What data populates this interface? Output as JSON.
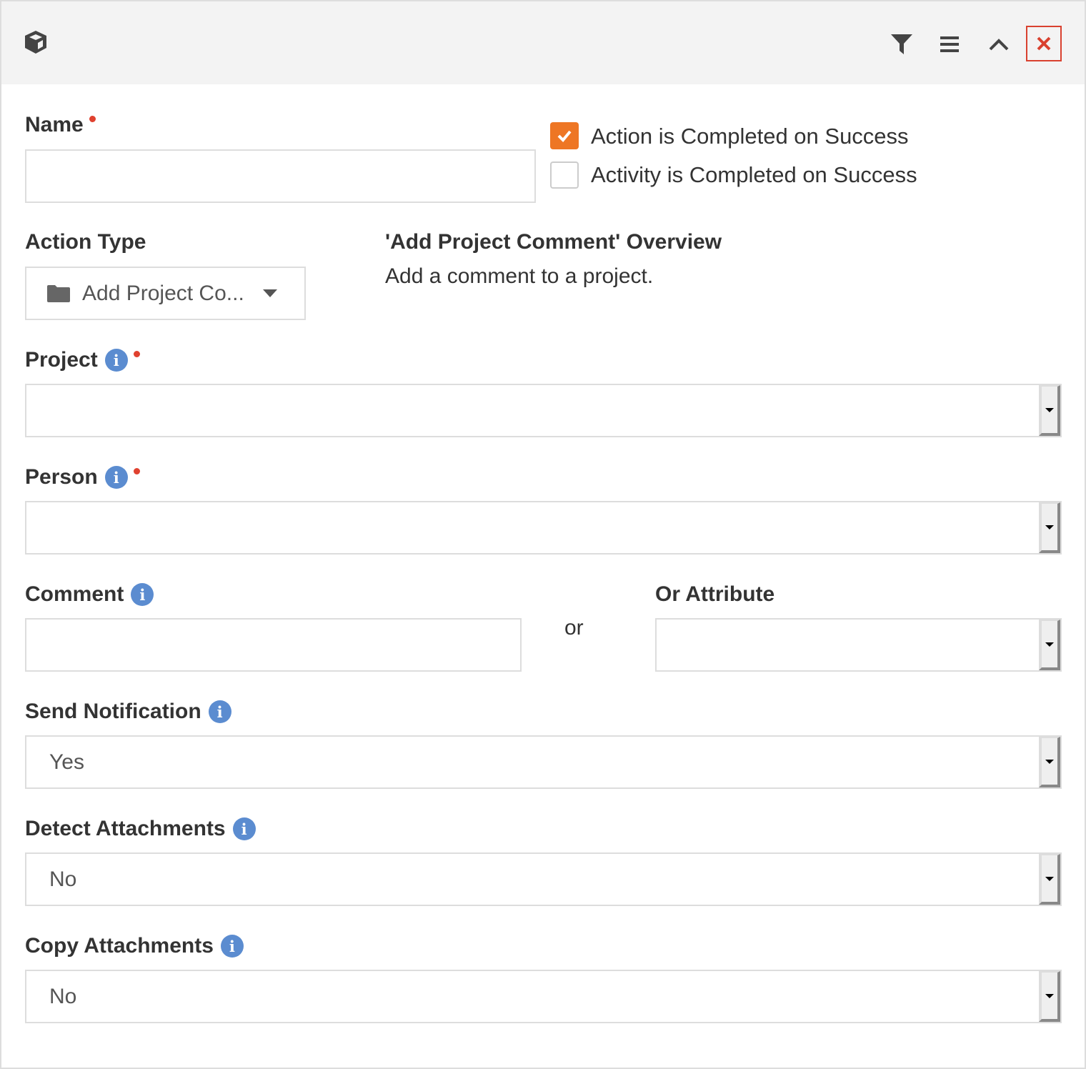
{
  "header": {
    "icons": [
      "cube-icon",
      "filter-icon",
      "menu-icon",
      "chevron-up-icon",
      "close-icon"
    ]
  },
  "colors": {
    "accent": "#ee7624",
    "required": "#e0412f",
    "info": "#5b8cd0",
    "close": "#d9412f"
  },
  "name": {
    "label": "Name",
    "value": ""
  },
  "checkboxes": [
    {
      "label": "Action is Completed on Success",
      "checked": true
    },
    {
      "label": "Activity is Completed on Success",
      "checked": false
    }
  ],
  "action_type": {
    "label": "Action Type",
    "value": "Add Project Co...",
    "icon": "folder-icon"
  },
  "overview": {
    "title": "'Add Project Comment' Overview",
    "text": "Add a comment to a project."
  },
  "project": {
    "label": "Project",
    "value": ""
  },
  "person": {
    "label": "Person",
    "value": ""
  },
  "comment": {
    "label": "Comment",
    "value": "",
    "or": "or"
  },
  "or_attribute": {
    "label": "Or Attribute",
    "value": ""
  },
  "send_notification": {
    "label": "Send Notification",
    "value": "Yes"
  },
  "detect_attachments": {
    "label": "Detect Attachments",
    "value": "No"
  },
  "copy_attachments": {
    "label": "Copy Attachments",
    "value": "No"
  },
  "info_glyph": "i"
}
